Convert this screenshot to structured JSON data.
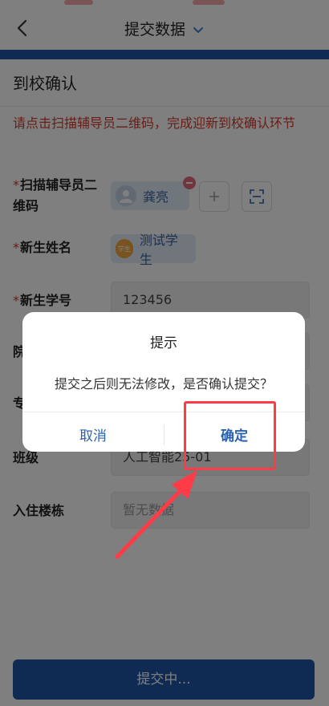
{
  "nav": {
    "title": "提交数据"
  },
  "section": {
    "title": "到校确认"
  },
  "notice": "请点击扫描辅导员二维码，完成迎新到校确认环节",
  "form": {
    "counselor": {
      "label": "扫描辅导员二维码",
      "value": "龚亮"
    },
    "name": {
      "label": "新生姓名",
      "value": "测试学生",
      "badge": "学生"
    },
    "student_id": {
      "label": "新生学号",
      "value": "123456"
    },
    "college": {
      "label": "院"
    },
    "major": {
      "label": "专"
    },
    "class": {
      "label": "班级",
      "value": "人工智能25-01"
    },
    "dorm": {
      "label": "入住楼栋",
      "placeholder": "暂无数据"
    }
  },
  "submit": {
    "label": "提交中..."
  },
  "dialog": {
    "title": "提示",
    "message": "提交之后则无法修改，是否确认提交？",
    "cancel": "取消",
    "confirm": "确定"
  },
  "colors": {
    "brand_blue": "#1f56a8",
    "required_red": "#d23b2f",
    "annotation_red": "#ff3b47"
  }
}
